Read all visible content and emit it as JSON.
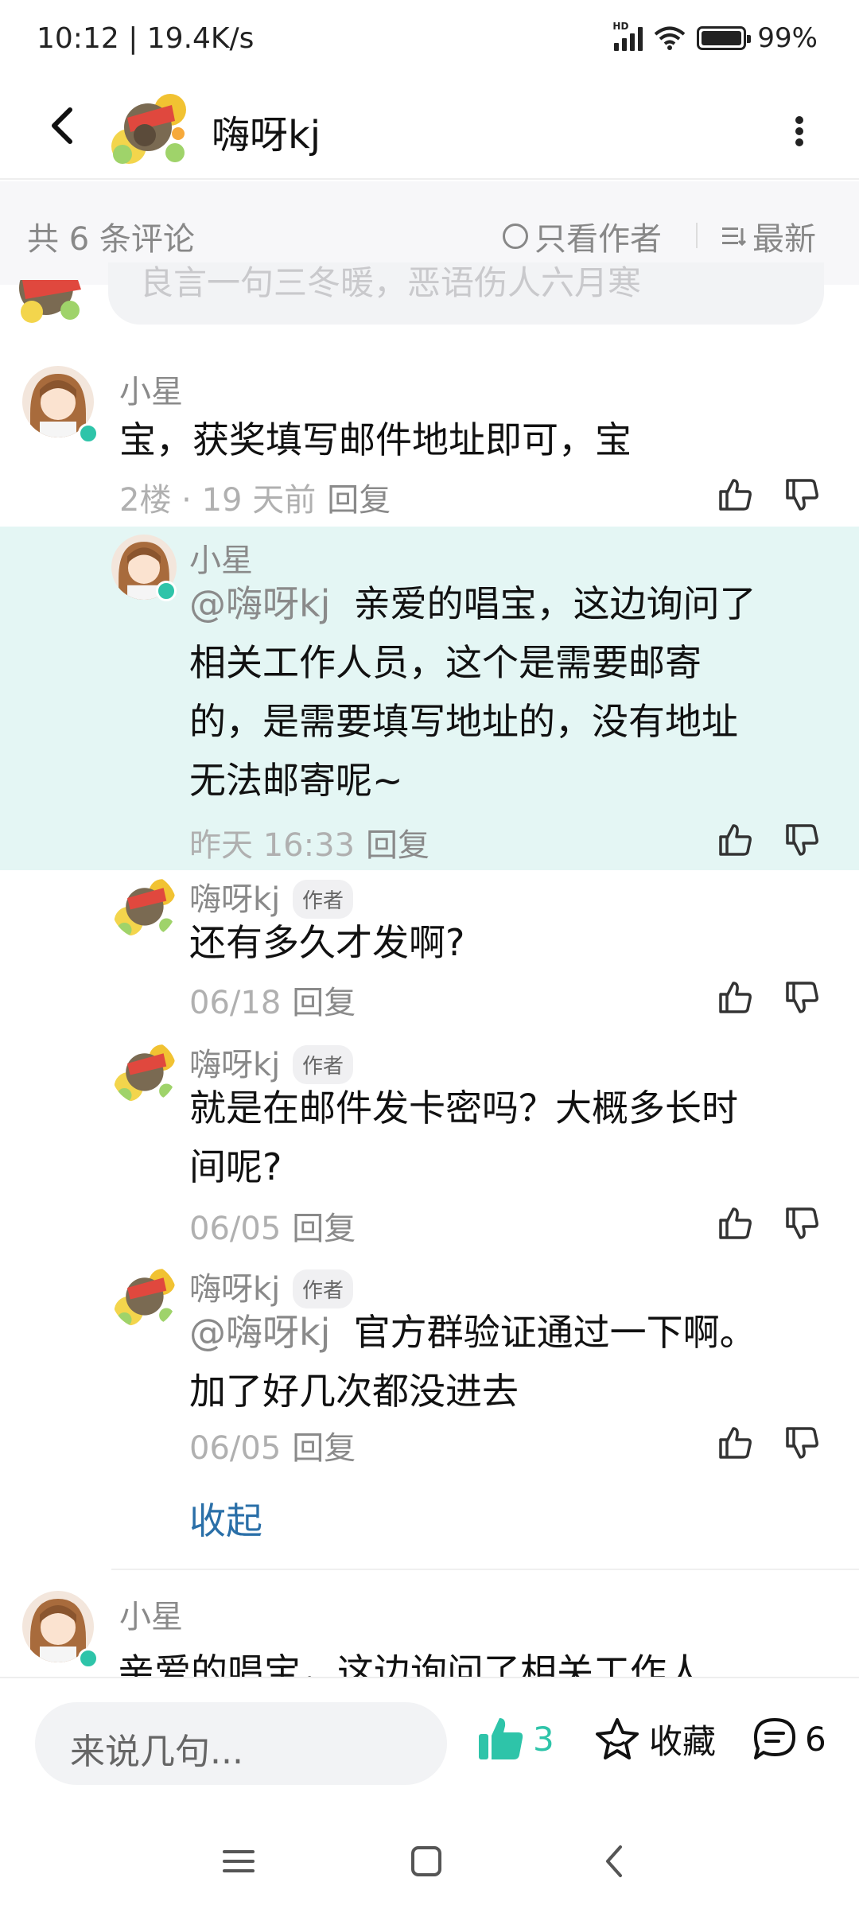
{
  "status_bar": {
    "time_speed": "10:12 | 19.4K/s",
    "battery_percent": "99%",
    "battery_level": 0.99,
    "signal_label": "HD"
  },
  "header": {
    "title": "嗨呀kj",
    "back_icon": "chevron-left-icon",
    "more_icon": "more-vertical-icon"
  },
  "comment_bar": {
    "count_label": "共 6 条评论",
    "only_author_label": "只看作者",
    "sort_label": "最新"
  },
  "previous_comment": {
    "text": "良言一句三冬暖，恶语伤人六月寒"
  },
  "comments": [
    {
      "user": "小星",
      "text": "宝，获奖填写邮件地址即可，宝",
      "time": "2楼 · 19 天前",
      "reply_label": "回复"
    }
  ],
  "replies": [
    {
      "user": "小星",
      "mention": "@嗨呀kj",
      "lines": [
        "亲爱的唱宝，这边询问了",
        "相关工作人员，这个是需要邮寄",
        "的，是需要填写地址的，没有地址",
        "无法邮寄呢~"
      ],
      "time": "昨天 16:33",
      "reply_label": "回复",
      "highlighted": true
    },
    {
      "user": "嗨呀kj",
      "author_tag": "作者",
      "lines": [
        "还有多久才发啊?"
      ],
      "time": "06/18",
      "reply_label": "回复"
    },
    {
      "user": "嗨呀kj",
      "author_tag": "作者",
      "lines": [
        "就是在邮件发卡密吗？大概多长时",
        "间呢?"
      ],
      "time": "06/05",
      "reply_label": "回复"
    },
    {
      "user": "嗨呀kj",
      "author_tag": "作者",
      "mention": "@嗨呀kj",
      "lines": [
        "官方群验证通过一下啊。",
        "加了好几次都没进去"
      ],
      "time": "06/05",
      "reply_label": "回复"
    }
  ],
  "collapse_label": "收起",
  "next_comment": {
    "user": "小星",
    "text": "亲爱的唱宝，这边询问了相关工作人"
  },
  "bottom_bar": {
    "input_placeholder": "来说几句...",
    "like_count": "3",
    "favorite_label": "收藏",
    "comment_count": "6",
    "accent_color": "#2ec4a9"
  },
  "system_nav": {
    "menu_icon": "menu-icon",
    "home_icon": "home-square-icon",
    "back_icon": "back-chevron-icon"
  }
}
